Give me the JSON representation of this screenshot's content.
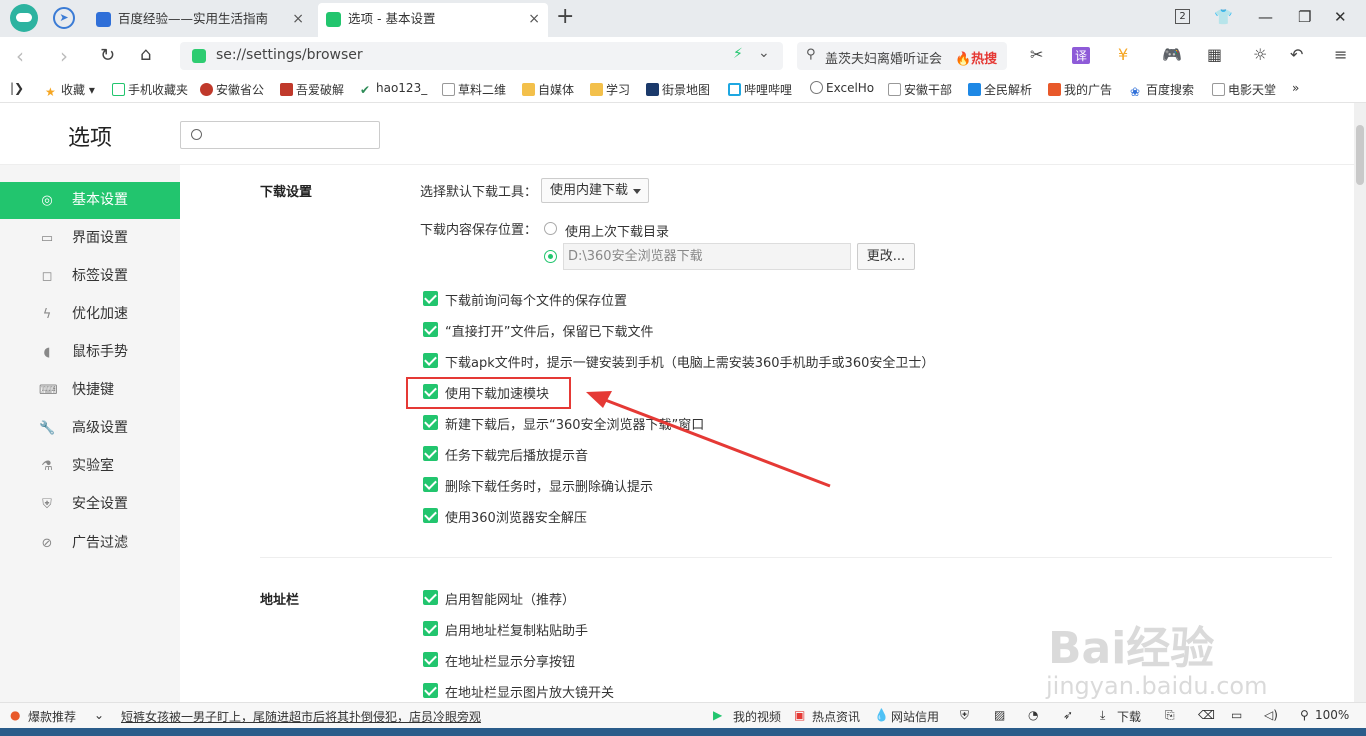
{
  "browser": {
    "tabs": [
      {
        "title": "百度经验——实用生活指南",
        "close": "×"
      },
      {
        "title": "选项 - 基本设置",
        "close": "×"
      }
    ],
    "new_tab": "+",
    "tab_count": "2",
    "url": "se://settings/browser",
    "search_text": "盖茨夫妇离婚听证会",
    "search_hot": "🔥热搜"
  },
  "bookmarks": [
    "收藏",
    "手机收藏夹",
    "安徽省公",
    "吾爱破解",
    "hao123_",
    "草料二维",
    "自媒体",
    "学习",
    "街景地图",
    "哔哩哔哩",
    "ExcelHo",
    "安徽干部",
    "全民解析",
    "我的广告",
    "百度搜索",
    "电影天堂"
  ],
  "page": {
    "title": "选项",
    "search_placeholder": ""
  },
  "sidebar": [
    {
      "label": "基本设置",
      "icon": "gear-icon",
      "active": true
    },
    {
      "label": "界面设置",
      "icon": "window-icon"
    },
    {
      "label": "标签设置",
      "icon": "tab-icon"
    },
    {
      "label": "优化加速",
      "icon": "bolt-icon"
    },
    {
      "label": "鼠标手势",
      "icon": "mouse-icon"
    },
    {
      "label": "快捷键",
      "icon": "keyboard-icon"
    },
    {
      "label": "高级设置",
      "icon": "wrench-icon"
    },
    {
      "label": "实验室",
      "icon": "flask-icon"
    },
    {
      "label": "安全设置",
      "icon": "shield-icon"
    },
    {
      "label": "广告过滤",
      "icon": "block-icon"
    }
  ],
  "download": {
    "section": "下载设置",
    "tool_label": "选择默认下载工具：",
    "tool_value": "使用内建下载",
    "save_label": "下载内容保存位置：",
    "radio_last": "使用上次下载目录",
    "path": "D:\\360安全浏览器下载",
    "change_btn": "更改...",
    "options": [
      "下载前询问每个文件的保存位置",
      "“直接打开”文件后，保留已下载文件",
      "下载apk文件时，提示一键安装到手机（电脑上需安装360手机助手或360安全卫士）",
      "使用下载加速模块",
      "新建下载后，显示“360安全浏览器下载”窗口",
      "任务下载完后播放提示音",
      "删除下载任务时，显示删除确认提示",
      "使用360浏览器安全解压"
    ]
  },
  "addressbar": {
    "section": "地址栏",
    "options": [
      "启用智能网址（推荐）",
      "启用地址栏复制粘贴助手",
      "在地址栏显示分享按钮",
      "在地址栏显示图片放大镜开关"
    ]
  },
  "status": {
    "promo": "爆款推荐",
    "news": "短裤女孩被一男子盯上，尾随进超市后将其扑倒侵犯，店员冷眼旁观",
    "video": "我的视频",
    "hot": "热点资讯",
    "credit": "网站信用",
    "download": "下载",
    "zoom": "100%"
  },
  "watermark": {
    "main": "Bai经验",
    "sub": "jingyan.baidu.com"
  }
}
